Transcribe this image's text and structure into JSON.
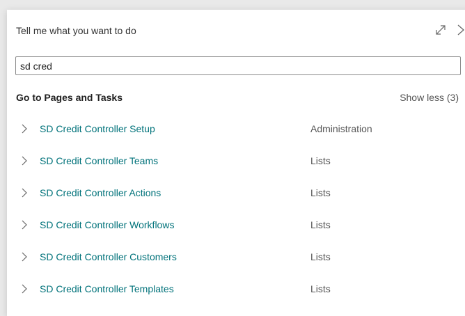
{
  "dialog": {
    "title": "Tell me what you want to do",
    "icons": {
      "expand": "expand-diagonal-icon",
      "close": "close-icon"
    }
  },
  "search": {
    "value": "sd cred",
    "placeholder": ""
  },
  "section": {
    "title": "Go to Pages and Tasks",
    "toggle_label": "Show less (3)"
  },
  "results": [
    {
      "name": "SD Credit Controller Setup",
      "category": "Administration"
    },
    {
      "name": "SD Credit Controller Teams",
      "category": "Lists"
    },
    {
      "name": "SD Credit Controller Actions",
      "category": "Lists"
    },
    {
      "name": "SD Credit Controller Workflows",
      "category": "Lists"
    },
    {
      "name": "SD Credit Controller Customers",
      "category": "Lists"
    },
    {
      "name": "SD Credit Controller Templates",
      "category": "Lists"
    }
  ],
  "colors": {
    "link": "#00727a",
    "muted": "#555555",
    "background": "#e9e9e9"
  }
}
